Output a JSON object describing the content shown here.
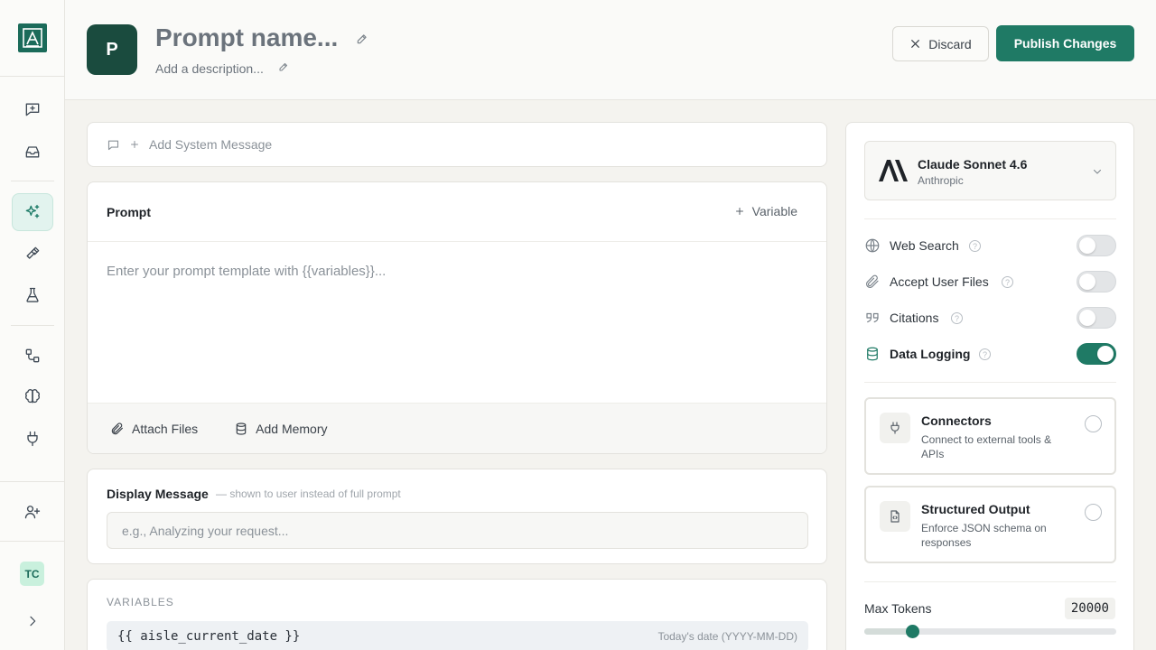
{
  "header": {
    "badge_letter": "P",
    "title": "Prompt name...",
    "description": "Add a description...",
    "discard_label": "Discard",
    "publish_label": "Publish Changes"
  },
  "sidebar": {
    "avatar_initials": "TC",
    "items": [
      "new-chat",
      "inbox",
      "prompts",
      "tools",
      "evals",
      "workflows",
      "memory",
      "integrations",
      "invite-user"
    ],
    "active": "prompts"
  },
  "system_message": {
    "label": "Add System Message"
  },
  "prompt": {
    "title": "Prompt",
    "variable_button": "Variable",
    "placeholder": "Enter your prompt template with {{variables}}...",
    "attach_files": "Attach Files",
    "add_memory": "Add Memory"
  },
  "display_message": {
    "title": "Display Message",
    "hint": "— shown to user instead of full prompt",
    "placeholder": "e.g., Analyzing your request..."
  },
  "variables": {
    "section_label": "VARIABLES",
    "items": [
      {
        "name": "{{ aisle_current_date }}",
        "description": "Today's date (YYYY-MM-DD)"
      }
    ]
  },
  "model": {
    "name": "Claude Sonnet 4.6",
    "vendor": "Anthropic"
  },
  "options": [
    {
      "label": "Web Search",
      "enabled": false
    },
    {
      "label": "Accept User Files",
      "enabled": false
    },
    {
      "label": "Citations",
      "enabled": false
    },
    {
      "label": "Data Logging",
      "enabled": true
    }
  ],
  "features": [
    {
      "title": "Connectors",
      "description": "Connect to external tools & APIs",
      "selected": false
    },
    {
      "title": "Structured Output",
      "description": "Enforce JSON schema on responses",
      "selected": false
    }
  ],
  "max_tokens": {
    "label": "Max Tokens",
    "value": "20000",
    "slider_fraction": 0.175
  },
  "colors": {
    "accent": "#1f7a65",
    "badge_bg": "#1a4b3e",
    "active_nav_bg": "#e2f3ee"
  }
}
